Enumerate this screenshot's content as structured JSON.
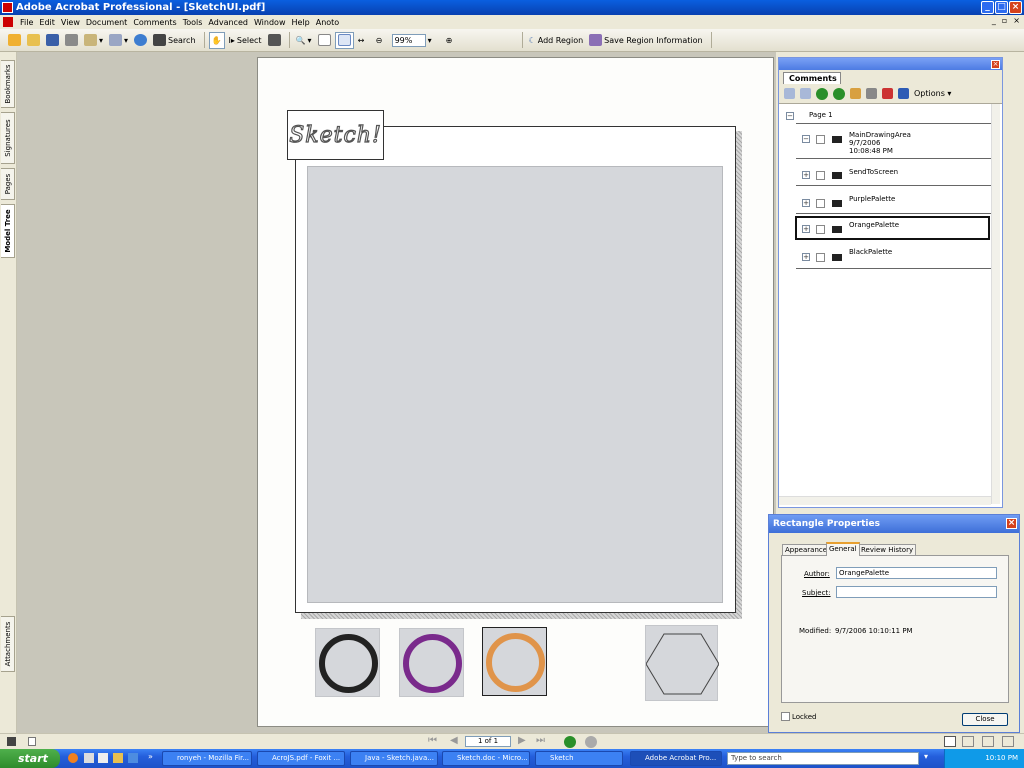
{
  "window": {
    "title": "Adobe Acrobat Professional - [SketchUI.pdf]",
    "min": "_",
    "max": "□",
    "close": "×",
    "mdi_min": "_",
    "mdi_restore": "▫",
    "mdi_close": "×"
  },
  "menu": [
    "File",
    "Edit",
    "View",
    "Document",
    "Comments",
    "Tools",
    "Advanced",
    "Window",
    "Help",
    "Anoto"
  ],
  "toolbar": {
    "search": "Search",
    "select": "Select",
    "zoom": "99%",
    "add_region": "Add Region",
    "save_region": "Save Region Information"
  },
  "leftnav": [
    "Bookmarks",
    "Signatures",
    "Pages",
    "Model Tree",
    "Attachments"
  ],
  "page": {
    "logo_text": "Sketch!"
  },
  "comments": {
    "tab": "Comments",
    "options": "Options",
    "page_label": "Page 1",
    "rows": [
      {
        "name": "MainDrawingArea",
        "date": "9/7/2006",
        "time": "10:08:48 PM",
        "expanded": true
      },
      {
        "name": "SendToScreen"
      },
      {
        "name": "PurplePalette"
      },
      {
        "name": "OrangePalette",
        "selected": true
      },
      {
        "name": "BlackPalette"
      }
    ]
  },
  "props": {
    "title": "Rectangle Properties",
    "tabs": [
      "Appearance",
      "General",
      "Review History"
    ],
    "active_tab": "General",
    "author_label": "Author:",
    "author_value": "OrangePalette",
    "subject_label": "Subject:",
    "subject_value": "",
    "modified_label": "Modified:",
    "modified_value": "9/7/2006 10:10:11 PM",
    "locked_label": "Locked",
    "close_label": "Close"
  },
  "status": {
    "page_indicator": "1 of 1"
  },
  "taskbar": {
    "start": "start",
    "items": [
      "ronyeh - Mozilla Fir...",
      "AcroJS.pdf - Foxit ...",
      "Java - Sketch.java...",
      "Sketch.doc - Micro...",
      "Sketch",
      "Adobe Acrobat Pro..."
    ],
    "search_placeholder": "Type to search",
    "clock": "10:10 PM"
  },
  "colors": {
    "black_ring": "#222222",
    "purple_ring": "#7a2a8c",
    "orange_ring": "#e0944a",
    "titlebar": "#0a5fe0"
  }
}
